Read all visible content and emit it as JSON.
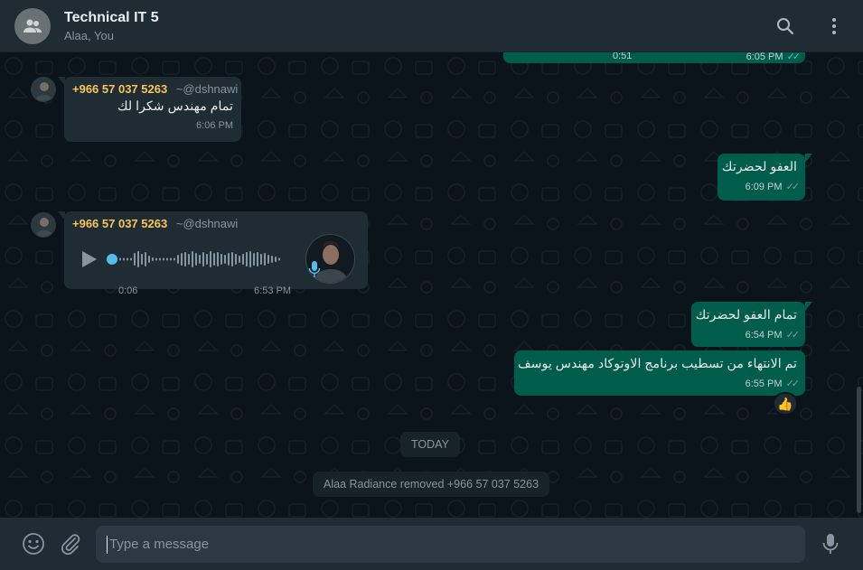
{
  "header": {
    "title": "Technical IT 5",
    "subtitle": "Alaa, You"
  },
  "messages": {
    "top_partial": {
      "duration": "0:51",
      "time": "6:05 PM"
    },
    "m1": {
      "phone": "+966 57 037 5263",
      "name": "~@dshnawi",
      "text": "تمام مهندس شكرا لك",
      "time": "6:06 PM"
    },
    "m2": {
      "text": "العفو لحضرتك",
      "time": "6:09 PM"
    },
    "m3": {
      "phone": "+966 57 037 5263",
      "name": "~@dshnawi",
      "duration": "0:06",
      "time": "6:53 PM"
    },
    "m4": {
      "text": "تمام العفو لحضرتك",
      "time": "6:54 PM"
    },
    "m5": {
      "text": "تم الانتهاء من تسطيب برنامج الاوتوكاد مهندس يوسف",
      "time": "6:55 PM",
      "reaction": "👍"
    }
  },
  "system": {
    "date_pill": "TODAY",
    "notice": "Alaa Radiance removed +966 57 037 5263"
  },
  "composer": {
    "placeholder": "Type a message"
  },
  "colors": {
    "header_bg": "#202c33",
    "chat_bg": "#0b141a",
    "incoming_bubble": "#202c33",
    "outgoing_bubble": "#005c4b",
    "sender_phone": "#f7c65b",
    "read_ticks": "#53bdeb"
  },
  "icons": [
    "group-avatar-icon",
    "search-icon",
    "menu-icon",
    "play-icon",
    "mic-icon",
    "emoji-icon",
    "attach-icon",
    "voice-record-icon"
  ]
}
